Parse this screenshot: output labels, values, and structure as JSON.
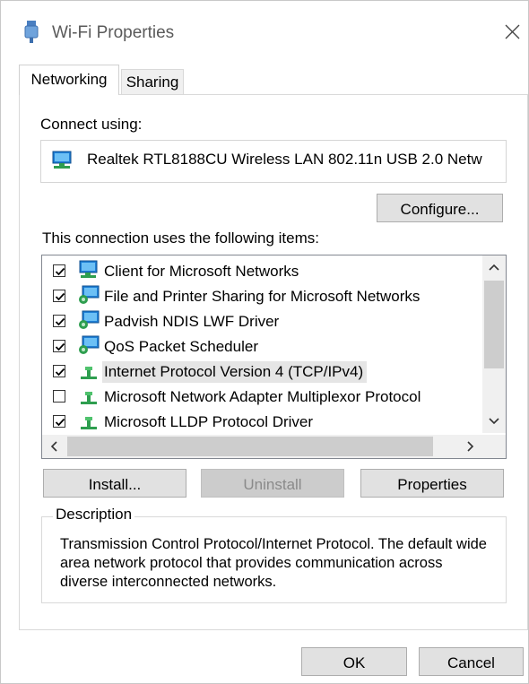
{
  "window": {
    "title": "Wi-Fi Properties",
    "icons": {
      "app": "network-adapter-icon",
      "close": "close-icon"
    }
  },
  "tabs": [
    {
      "label": "Networking",
      "active": true
    },
    {
      "label": "Sharing",
      "active": false
    }
  ],
  "connect_using": {
    "label": "Connect using:",
    "adapter_name": "Realtek RTL8188CU Wireless LAN 802.11n USB 2.0 Netw",
    "icon": "network-adapter-icon"
  },
  "configure_label": "Configure...",
  "items_label": "This connection uses the following items:",
  "items": [
    {
      "label": "Client for Microsoft Networks",
      "checked": true,
      "icon": "network-client-icon"
    },
    {
      "label": "File and Printer Sharing for Microsoft Networks",
      "checked": true,
      "icon": "network-service-icon"
    },
    {
      "label": "Padvish NDIS LWF Driver",
      "checked": true,
      "icon": "network-service-icon"
    },
    {
      "label": "QoS Packet Scheduler",
      "checked": true,
      "icon": "network-service-icon"
    },
    {
      "label": "Internet Protocol Version 4 (TCP/IPv4)",
      "checked": true,
      "icon": "protocol-icon",
      "selected": true
    },
    {
      "label": "Microsoft Network Adapter Multiplexor Protocol",
      "checked": false,
      "icon": "protocol-icon"
    },
    {
      "label": "Microsoft LLDP Protocol Driver",
      "checked": true,
      "icon": "protocol-icon"
    }
  ],
  "buttons": {
    "install": "Install...",
    "uninstall": "Uninstall",
    "properties": "Properties",
    "ok": "OK",
    "cancel": "Cancel"
  },
  "description": {
    "legend": "Description",
    "text": "Transmission Control Protocol/Internet Protocol. The default wide area network protocol that provides communication across diverse interconnected networks."
  },
  "colors": {
    "button_bg": "#e1e1e1",
    "selected_row": "#e5e5e5",
    "icon_blue": "#1e7fd6",
    "icon_green": "#2e9e4f"
  }
}
